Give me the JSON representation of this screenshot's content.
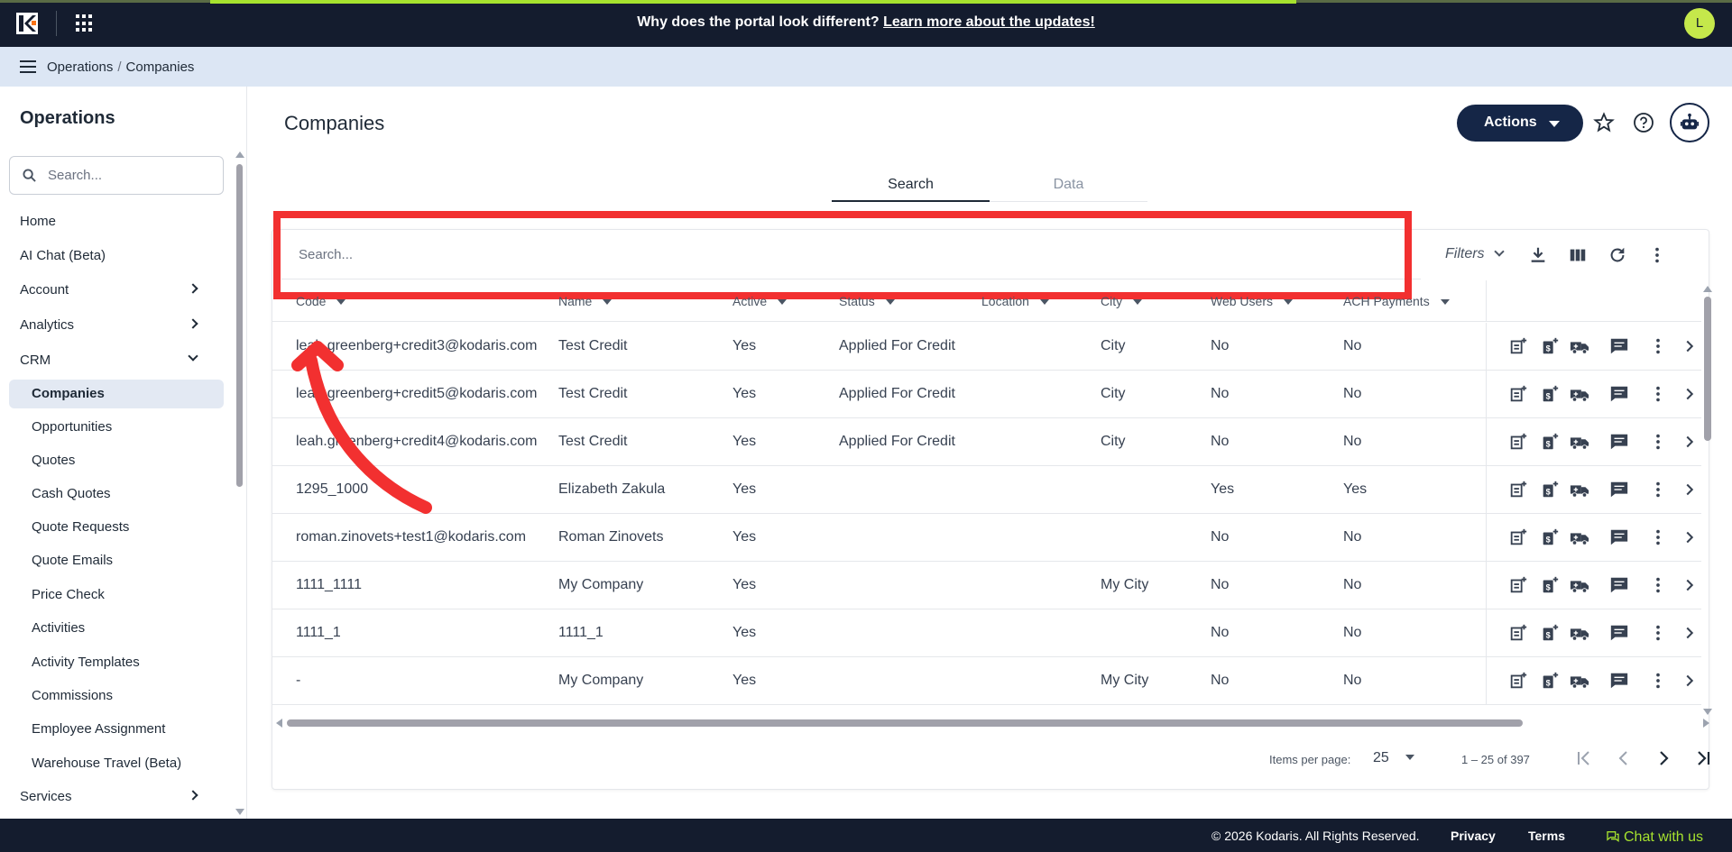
{
  "banner": {
    "text": "Why does the portal look different? ",
    "link": "Learn more about the updates!"
  },
  "user": {
    "initial": "L"
  },
  "breadcrumb": {
    "parent": "Operations",
    "sep": "/",
    "current": "Companies"
  },
  "sidebar": {
    "title": "Operations",
    "search_placeholder": "Search...",
    "items": [
      {
        "label": "Home"
      },
      {
        "label": "AI Chat (Beta)"
      },
      {
        "label": "Account"
      },
      {
        "label": "Analytics"
      },
      {
        "label": "CRM"
      },
      {
        "label": "Companies"
      },
      {
        "label": "Opportunities"
      },
      {
        "label": "Quotes"
      },
      {
        "label": "Cash Quotes"
      },
      {
        "label": "Quote Requests"
      },
      {
        "label": "Quote Emails"
      },
      {
        "label": "Price Check"
      },
      {
        "label": "Activities"
      },
      {
        "label": "Activity Templates"
      },
      {
        "label": "Commissions"
      },
      {
        "label": "Employee Assignment"
      },
      {
        "label": "Warehouse Travel (Beta)"
      },
      {
        "label": "Services"
      }
    ]
  },
  "page": {
    "title": "Companies",
    "actions_label": "Actions",
    "tabs": [
      {
        "label": "Search"
      },
      {
        "label": "Data"
      }
    ]
  },
  "toolbar": {
    "search_placeholder": "Search...",
    "filters_label": "Filters"
  },
  "table": {
    "columns": [
      "Code",
      "Name",
      "Active",
      "Status",
      "Location",
      "City",
      "Web Users",
      "ACH Payments"
    ],
    "rows": [
      [
        "leah.greenberg+credit3@kodaris.com",
        "Test Credit",
        "Yes",
        "Applied For Credit",
        "",
        "City",
        "No",
        "No"
      ],
      [
        "leah.greenberg+credit5@kodaris.com",
        "Test Credit",
        "Yes",
        "Applied For Credit",
        "",
        "City",
        "No",
        "No"
      ],
      [
        "leah.greenberg+credit4@kodaris.com",
        "Test Credit",
        "Yes",
        "Applied For Credit",
        "",
        "City",
        "No",
        "No"
      ],
      [
        "1295_1000",
        "Elizabeth Zakula",
        "Yes",
        "",
        "",
        "",
        "Yes",
        "Yes"
      ],
      [
        "roman.zinovets+test1@kodaris.com",
        "Roman Zinovets",
        "Yes",
        "",
        "",
        "",
        "No",
        "No"
      ],
      [
        "1111_1111",
        "My Company",
        "Yes",
        "",
        "",
        "My City",
        "No",
        "No"
      ],
      [
        "1111_1",
        "1111_1",
        "Yes",
        "",
        "",
        "",
        "No",
        "No"
      ],
      [
        "-",
        "My Company",
        "Yes",
        "",
        "",
        "My City",
        "No",
        "No"
      ]
    ]
  },
  "paginator": {
    "items_per_page_label": "Items per page:",
    "page_size": "25",
    "range": "1 – 25 of 397"
  },
  "footer": {
    "copyright": "© 2026 Kodaris. All Rights Reserved.",
    "privacy": "Privacy",
    "terms": "Terms",
    "chat": "Chat with us"
  },
  "icons": {
    "row_actions": [
      "note-add-icon",
      "money-add-icon",
      "truck-icon",
      "comment-icon",
      "more-vert-icon",
      "chevron-right-icon"
    ],
    "toolbar": [
      "download-icon",
      "columns-icon",
      "refresh-icon",
      "more-vert-icon"
    ]
  },
  "colors": {
    "topbar": "#141c2e",
    "accent": "#a6e22e",
    "actions_button": "#152647",
    "highlight": "#f23030"
  }
}
